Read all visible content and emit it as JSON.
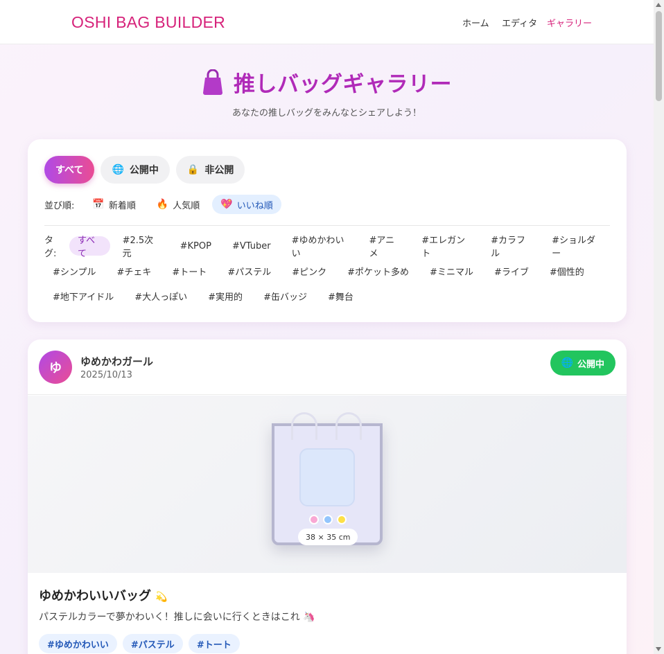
{
  "app": {
    "brand": "OSHI BAG BUILDER"
  },
  "nav": {
    "home": "ホーム",
    "editor": "エディタ",
    "gallery": "ギャラリー"
  },
  "page": {
    "title": "推しバッグギャラリー",
    "subtitle": "あなたの推しバッグをみんなとシェアしよう！"
  },
  "visibility": {
    "all": "すべて",
    "public": "公開中",
    "private": "非公開"
  },
  "sort": {
    "label": "並び順:",
    "newest": "新着順",
    "popular": "人気順",
    "likes": "いいね順",
    "selected": "いいね順"
  },
  "tags": {
    "label": "タグ:",
    "row1": [
      "すべて",
      "#2.5次元",
      "#KPOP",
      "#VTuber",
      "#ゆめかわいい",
      "#アニメ",
      "#エレガント",
      "#カラフル",
      "#ショルダー"
    ],
    "row2": [
      "#シンプル",
      "#チェキ",
      "#トート",
      "#パステル",
      "#ピンク",
      "#ポケット多め",
      "#ミニマル",
      "#ライブ",
      "#個性的"
    ],
    "row3": [
      "#地下アイドル",
      "#大人っぽい",
      "#実用的",
      "#缶バッジ",
      "#舞台"
    ]
  },
  "post": {
    "avatar_initial": "ゆ",
    "username": "ゆめかわガール",
    "date": "2025/10/13",
    "status": "公開中",
    "size": "38 × 35 cm",
    "title": "ゆめかわいいバッグ",
    "title_emoji": "💫",
    "description": "パステルカラーで夢かわいく！推しに会いに行くときはこれ",
    "description_emoji": "🦄",
    "tags": [
      "#ゆめかわいい",
      "#パステル",
      "#トート"
    ],
    "dot_colors": [
      "#f9a8d4",
      "#93c5fd",
      "#fde047"
    ]
  },
  "colors": {
    "accent": "#d6227a",
    "title": "#b02ab8",
    "public_green": "#22c55e"
  }
}
